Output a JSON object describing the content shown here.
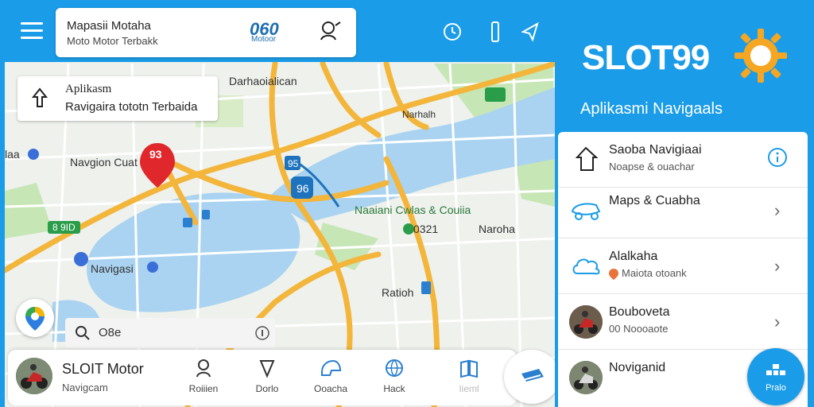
{
  "header": {
    "search_title": "Mapasii Motaha",
    "search_subtitle": "Moto Motor Terbakk",
    "logo_text": "060",
    "logo_sub": "Motoor"
  },
  "info_card": {
    "line1": "Aplikasm",
    "line2": "Ravigaira tototn Terbaida"
  },
  "map_labels": {
    "top_district": "Darhaoialican",
    "river_road": "Narhalh",
    "pin_place": "Navgion Cuat",
    "left_edge": "laa",
    "center_place": "Naaiani Cwlas & Couiia",
    "center_code": "0321",
    "right_place": "Naroha",
    "green_badge": "8 9ID",
    "bottom_left_place": "Navigasi",
    "bottom_place": "Ratioh",
    "pin_number": "93",
    "road_num_1": "95",
    "road_num_2": "96"
  },
  "mini_search": {
    "query": "O8e"
  },
  "bottom_bar": {
    "name": "SLOIT Motor",
    "sub": "Navigcam",
    "nav": [
      {
        "label": "Roiiien",
        "icon": "person-pin-icon"
      },
      {
        "label": "Dorlo",
        "icon": "navigation-arrow-icon"
      },
      {
        "label": "Ooacha",
        "icon": "helmet-icon"
      },
      {
        "label": "Hack",
        "icon": "globe-icon"
      },
      {
        "label": "Iieml",
        "icon": "map-book-icon"
      }
    ]
  },
  "right_panel": {
    "brand": "SLOT99",
    "tagline": "Aplikasmi Navigaals",
    "items": [
      {
        "title": "Saoba Navigiaai",
        "subtitle": "Noapse & ouachar",
        "icon": "upload-house-icon",
        "action": "info-icon"
      },
      {
        "title": "Maps & Cuabha",
        "subtitle": "",
        "icon": "scooter-icon",
        "action": "chevron-right-icon"
      },
      {
        "title": "Alalkaha",
        "subtitle": "Maiota otoank",
        "icon": "cloud-icon",
        "action": "chevron-right-icon"
      },
      {
        "title": "Bouboveta",
        "subtitle": "00 Noooaote",
        "icon": "rider-avatar",
        "action": "chevron-right-icon"
      },
      {
        "title": "Noviganid",
        "subtitle": "",
        "icon": "scooter-avatar",
        "action": ""
      }
    ],
    "fab_label": "Pralo"
  },
  "colors": {
    "brand_blue": "#1a9ce8",
    "road_orange": "#f3b53a",
    "water": "#a9d3f0",
    "park": "#c7e6b6",
    "pin_red": "#e0282c",
    "sun_orange": "#f5a623"
  }
}
